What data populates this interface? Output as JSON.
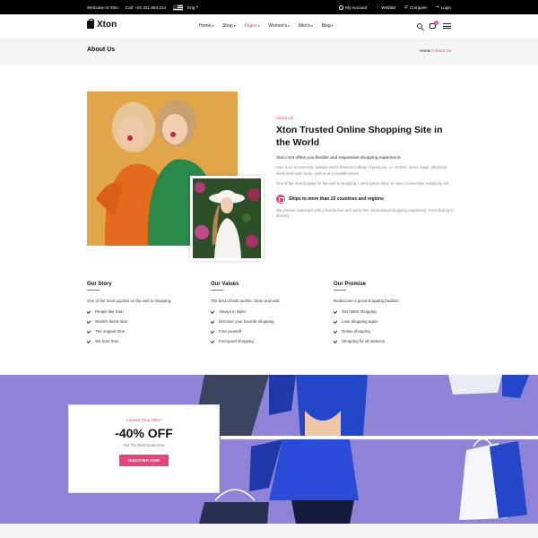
{
  "topbar": {
    "welcome": "Welcome to Xton",
    "call": "Call: +01 321 654 214",
    "language": "Eng",
    "my_account": "My Account",
    "wishlist": "Wishlist",
    "compare": "Compare",
    "login": "Login"
  },
  "header": {
    "brand": "Xton",
    "nav": [
      "Home",
      "Shop",
      "Pages",
      "Women's",
      "Men's",
      "Blog"
    ],
    "active_nav": "Pages",
    "cart_count": "0"
  },
  "breadcrumb": {
    "page_title": "About Us",
    "home": "Home",
    "separator": "/",
    "current": "About Us"
  },
  "about": {
    "tag": "About Us",
    "heading": "Xton Trusted Online Shopping Site in the World",
    "lead": "Xton.com offers you flexible and responsive shopping experience.",
    "paragraph1": "Xton is an eCommerce website which features millions of products, i.e. clothes, shoes, bags, electronic items and much more, with us at incredible prices.",
    "paragraph2": "One of the most popular on the web is shopping. Lorem ipsum dolor sit amet, consectetur adipiscing elit.",
    "shipping": "Ships to more than 10 countries and regions",
    "paragraph3": "We provide customers with a hassle-free and worry-free international shopping experience. From buying to delivery."
  },
  "columns": [
    {
      "title": "Our Story",
      "sub": "One of the most popular on the web is shopping.",
      "items": [
        "People like Xton",
        "World's finest Xton",
        "The original Xton",
        "We trust Xton"
      ]
    },
    {
      "title": "Our Values",
      "sub": "The best of both worlds. Store and web.",
      "items": [
        "Always in style!",
        "Discover your favorite shopping",
        "Find yourself",
        "Feel-good shopping"
      ]
    },
    {
      "title": "Our Promise",
      "sub": "Rediscover a great shopping tradition",
      "items": [
        "Get better shopping",
        "Love shopping again",
        "Online shopping.",
        "Shopping for all seasons"
      ]
    }
  ],
  "promo": {
    "label": "Limited Time Offer!",
    "discount": "-40% OFF",
    "subtitle": "Get The Best Deals Now",
    "button": "DISCOVER NOW"
  },
  "colors": {
    "accent": "#e8437a",
    "promo_bg": "#8e83d6",
    "topbar_bg": "#000000"
  }
}
